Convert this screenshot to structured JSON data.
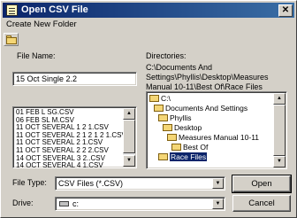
{
  "window": {
    "title": "Open CSV File"
  },
  "menu": {
    "new_folder": "Create New Folder"
  },
  "file_name": {
    "label": "File Name:",
    "value": "15 Oct Single 2.2",
    "files": [
      "01 FEB L SG.CSV",
      "06 FEB SL M.CSV",
      "11 OCT SEVERAL 1 2 1.CSV",
      "11 OCT SEVERAL 2 1 2 1 2 1.CSV",
      "11 OCT SEVERAL 2 1.CSV",
      "11 OCT SEVERAL 2 2 2.CSV",
      "14 OCT SEVERAL 3 2..CSV",
      "14 OCT SEVERAL 4 1.CSV",
      "15 OCT 4 1.CSV"
    ]
  },
  "directories": {
    "label": "Directories:",
    "path_text": "C:\\Documents And Settings\\Phyllis\\Desktop\\Measures Manual 10-11\\Best Of\\Race Files",
    "tree": [
      "C:\\",
      "Documents And Settings",
      "Phyllis",
      "Desktop",
      "Measures Manual 10-11",
      "Best Of",
      "Race Files"
    ],
    "selected": "Race Files"
  },
  "file_type": {
    "label": "File Type:",
    "value": "CSV Files (*.CSV)"
  },
  "drive": {
    "label": "Drive:",
    "value": "c:"
  },
  "buttons": {
    "open": "Open",
    "cancel": "Cancel"
  }
}
